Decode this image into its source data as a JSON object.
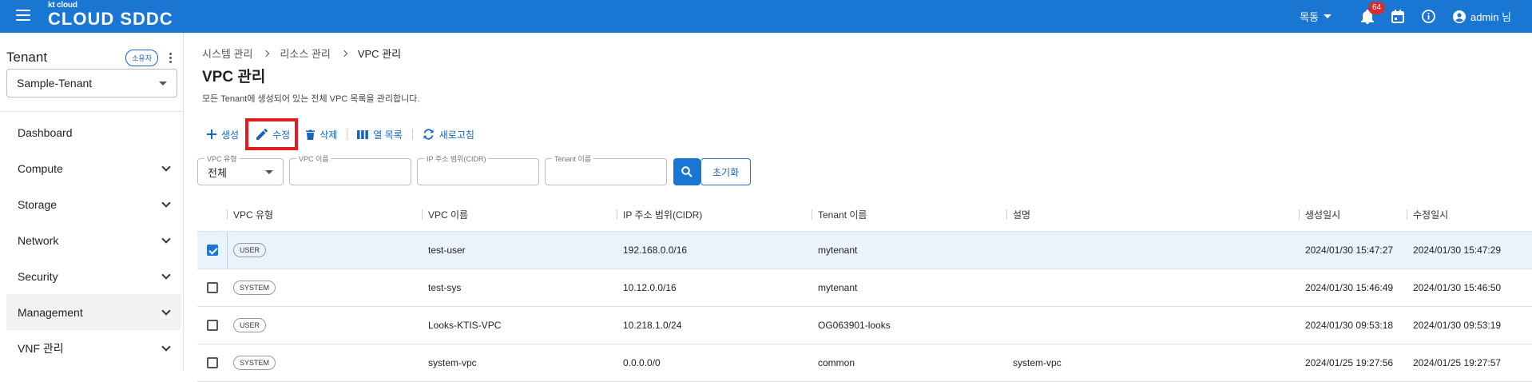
{
  "header": {
    "brand_small": "kt cloud",
    "brand_big": "CLOUD SDDC",
    "language": "목동",
    "notification_count": "64",
    "user": "admin 님"
  },
  "sidebar": {
    "tenant_title": "Tenant",
    "owner_chip": "소유자",
    "tenant_value": "Sample-Tenant",
    "items": [
      {
        "label": "Dashboard"
      },
      {
        "label": "Compute"
      },
      {
        "label": "Storage"
      },
      {
        "label": "Network"
      },
      {
        "label": "Security"
      },
      {
        "label": "Management"
      },
      {
        "label": "VNF 관리"
      }
    ]
  },
  "breadcrumb": [
    "시스템 관리",
    "리소스 관리",
    "VPC 관리"
  ],
  "page": {
    "title": "VPC 관리",
    "description": "모든 Tenant에 생성되어 있는 전체 VPC 목록을 관리합니다."
  },
  "toolbar": {
    "create": "생성",
    "edit": "수정",
    "delete": "삭제",
    "columns": "열 목록",
    "refresh": "새로고침"
  },
  "filters": {
    "vpc_type_label": "VPC 유형",
    "vpc_type_value": "전체",
    "vpc_name_label": "VPC 이름",
    "cidr_label": "IP 주소 범위(CIDR)",
    "tenant_label": "Tenant 이름",
    "reset": "초기화"
  },
  "table": {
    "headers": [
      "VPC 유형",
      "VPC 이름",
      "IP 주소 범위(CIDR)",
      "Tenant 이름",
      "설명",
      "생성일시",
      "수정일시"
    ],
    "rows": [
      {
        "checked": true,
        "type": "USER",
        "name": "test-user",
        "cidr": "192.168.0.0/16",
        "tenant": "mytenant",
        "desc": "",
        "created": "2024/01/30 15:47:27",
        "modified": "2024/01/30 15:47:29"
      },
      {
        "checked": false,
        "type": "SYSTEM",
        "name": "test-sys",
        "cidr": "10.12.0.0/16",
        "tenant": "mytenant",
        "desc": "",
        "created": "2024/01/30 15:46:49",
        "modified": "2024/01/30 15:46:50"
      },
      {
        "checked": false,
        "type": "USER",
        "name": "Looks-KTIS-VPC",
        "cidr": "10.218.1.0/24",
        "tenant": "OG063901-looks",
        "desc": "",
        "created": "2024/01/30 09:53:18",
        "modified": "2024/01/30 09:53:19"
      },
      {
        "checked": false,
        "type": "SYSTEM",
        "name": "system-vpc",
        "cidr": "0.0.0.0/0",
        "tenant": "common",
        "desc": "system-vpc",
        "created": "2024/01/25 19:27:56",
        "modified": "2024/01/25 19:27:57"
      }
    ]
  },
  "colors": {
    "primary": "#1976d2",
    "highlight": "#e31b1b",
    "badge": "#d32f2f"
  }
}
